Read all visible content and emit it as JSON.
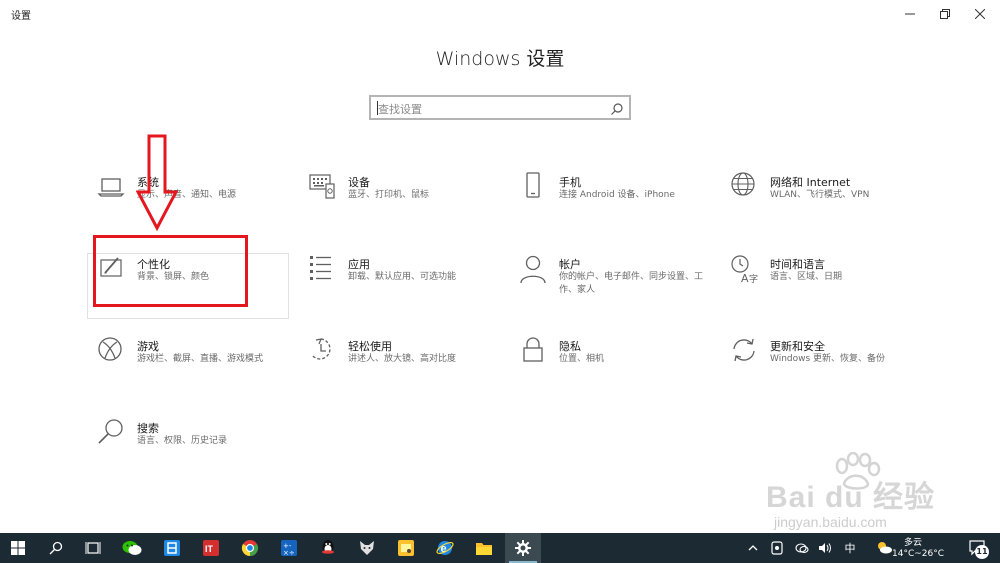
{
  "window": {
    "title": "设置"
  },
  "heading": "Windows 设置",
  "search": {
    "placeholder": "查找设置"
  },
  "tiles": [
    {
      "name": "系统",
      "desc": "显示、声音、通知、电源",
      "icon": "laptop-icon"
    },
    {
      "name": "设备",
      "desc": "蓝牙、打印机、鼠标",
      "icon": "keyboard-device-icon"
    },
    {
      "name": "手机",
      "desc": "连接 Android 设备、iPhone",
      "icon": "phone-icon"
    },
    {
      "name": "网络和 Internet",
      "desc": "WLAN、飞行模式、VPN",
      "icon": "globe-icon"
    },
    {
      "name": "个性化",
      "desc": "背景、锁屏、颜色",
      "icon": "paint-icon"
    },
    {
      "name": "应用",
      "desc": "卸载、默认应用、可选功能",
      "icon": "apps-list-icon"
    },
    {
      "name": "帐户",
      "desc": "你的帐户、电子邮件、同步设置、工作、家人",
      "icon": "person-icon"
    },
    {
      "name": "时间和语言",
      "desc": "语言、区域、日期",
      "icon": "time-language-icon"
    },
    {
      "name": "游戏",
      "desc": "游戏栏、截屏、直播、游戏模式",
      "icon": "xbox-icon"
    },
    {
      "name": "轻松使用",
      "desc": "讲述人、放大镜、高对比度",
      "icon": "ease-of-access-icon"
    },
    {
      "name": "隐私",
      "desc": "位置、相机",
      "icon": "lock-icon"
    },
    {
      "name": "更新和安全",
      "desc": "Windows 更新、恢复、备份",
      "icon": "sync-icon"
    },
    {
      "name": "搜索",
      "desc": "语言、权限、历史记录",
      "icon": "search-icon"
    }
  ],
  "watermark": {
    "brand": "Bai du 经验",
    "url": "jingyan.baidu.com"
  },
  "taskbar": {
    "ime": "中",
    "weather": {
      "condition": "多云",
      "temperature": "14°C~26°C"
    },
    "notification_count": "11"
  },
  "colors": {
    "highlight": "#e4161e",
    "taskbar": "#1c2b33",
    "icon": "#5f5f5f"
  }
}
